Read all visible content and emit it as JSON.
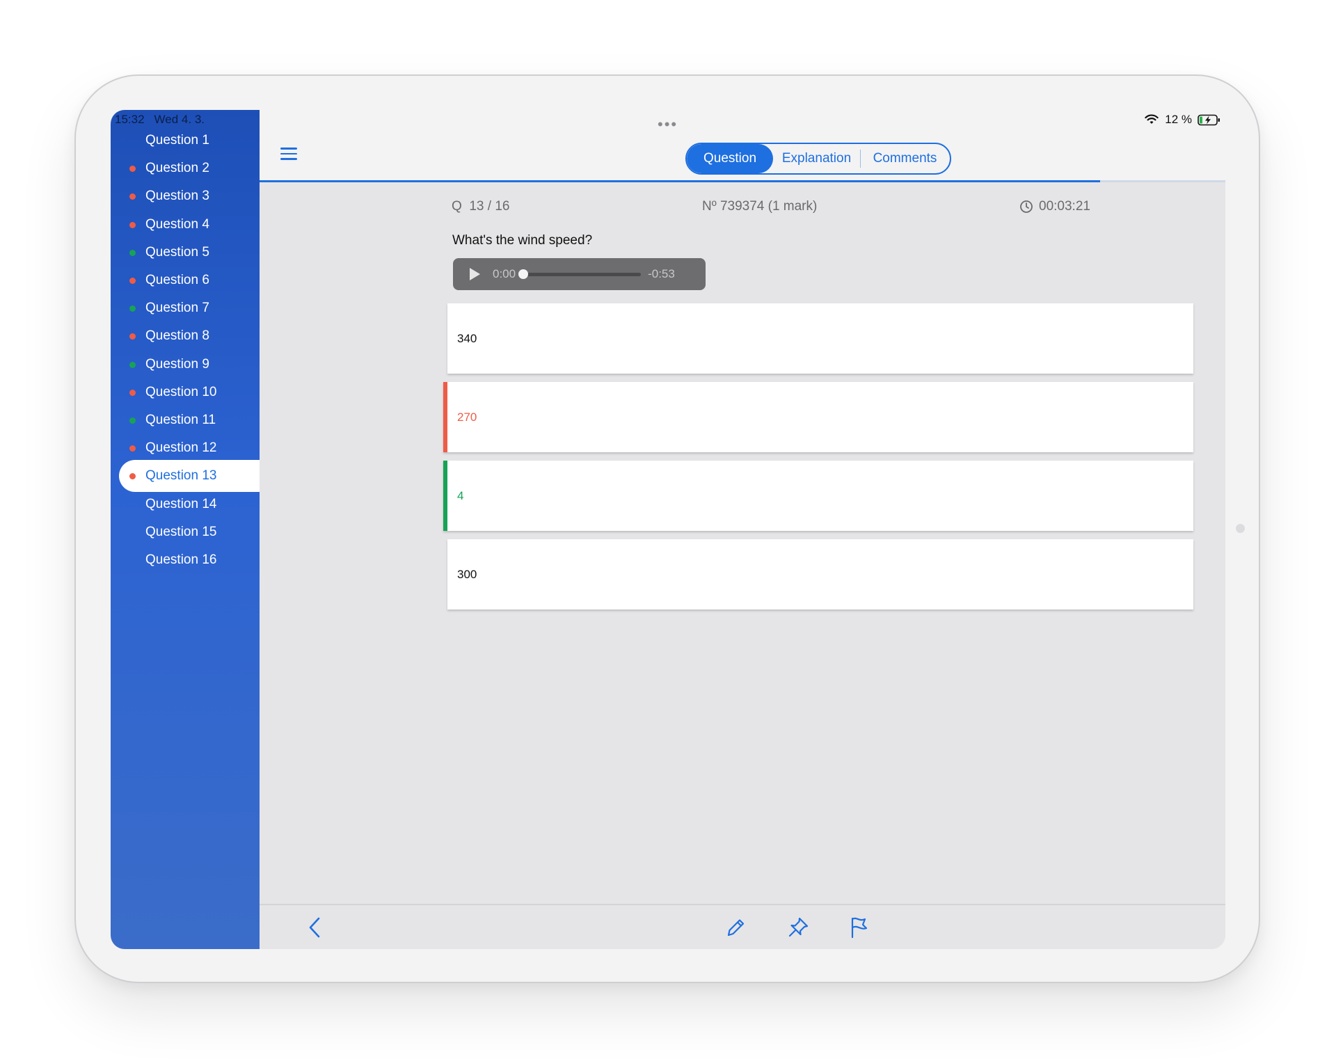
{
  "status_bar": {
    "time": "15:32",
    "date": "Wed 4. 3.",
    "more_icon": "ellipsis-icon",
    "battery_text": "12 %",
    "wifi_icon": "wifi-icon",
    "battery_icon": "battery-charging-icon"
  },
  "sidebar": {
    "items": [
      {
        "label": "Question 1",
        "status": null
      },
      {
        "label": "Question 2",
        "status": "wrong"
      },
      {
        "label": "Question 3",
        "status": "wrong"
      },
      {
        "label": "Question 4",
        "status": "wrong"
      },
      {
        "label": "Question 5",
        "status": "correct"
      },
      {
        "label": "Question 6",
        "status": "wrong"
      },
      {
        "label": "Question 7",
        "status": "correct"
      },
      {
        "label": "Question 8",
        "status": "wrong"
      },
      {
        "label": "Question 9",
        "status": "correct"
      },
      {
        "label": "Question 10",
        "status": "wrong"
      },
      {
        "label": "Question 11",
        "status": "correct"
      },
      {
        "label": "Question 12",
        "status": "wrong"
      },
      {
        "label": "Question 13",
        "status": "wrong",
        "active": true
      },
      {
        "label": "Question 14",
        "status": null
      },
      {
        "label": "Question 15",
        "status": null
      },
      {
        "label": "Question 16",
        "status": null
      }
    ]
  },
  "header": {
    "menu_icon": "hamburger-menu-icon",
    "tabs": [
      "Question",
      "Explanation",
      "Comments"
    ],
    "active_tab": "Question",
    "progress_fraction": 0.87
  },
  "question": {
    "counter_prefix": "Q",
    "counter": "13 / 16",
    "number": "Nº 739374 (1 mark)",
    "timer": "00:03:21",
    "text": "What's the wind speed?",
    "audio": {
      "elapsed": "0:00",
      "remaining": "-0:53",
      "position_fraction": 0.0
    }
  },
  "answers": [
    {
      "text": "340",
      "state": "neutral"
    },
    {
      "text": "270",
      "state": "wrong"
    },
    {
      "text": "4",
      "state": "correct"
    },
    {
      "text": "300",
      "state": "neutral"
    }
  ],
  "toolbar": {
    "back_icon": "chevron-left-icon",
    "edit_icon": "pencil-icon",
    "pin_icon": "pin-icon",
    "flag_icon": "flag-icon"
  },
  "colors": {
    "accent": "#1e6fe0",
    "wrong": "#ee5c47",
    "correct": "#17a356",
    "sidebar_top": "#1e4fb7",
    "sidebar_bottom": "#3b6cc9"
  }
}
